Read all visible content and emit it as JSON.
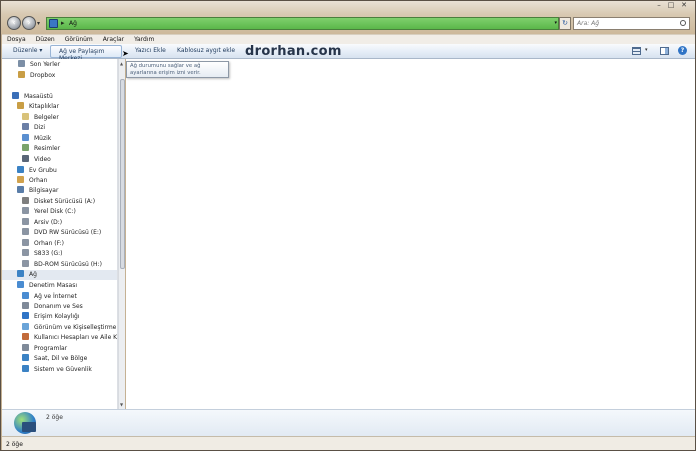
{
  "address": {
    "path": "Ağ"
  },
  "search": {
    "placeholder": "Ara: Ağ"
  },
  "menu": [
    "Dosya",
    "Düzen",
    "Görünüm",
    "Araçlar",
    "Yardım"
  ],
  "commands": {
    "organize": "Düzenle",
    "network_center": "Ağ ve Paylaşım Merkezi",
    "add_printer": "Yazıcı Ekle",
    "add_wireless": "Kablosuz aygıt ekle"
  },
  "watermark": "drorhan.com",
  "tooltip": "Ağ durumunu sağlar ve ağ ayarlarına erişim izni verir.",
  "nav": [
    {
      "label": "Son Yerler",
      "color": "#7c8fa6"
    },
    {
      "label": "Dropbox",
      "color": "#c99e45"
    },
    {
      "label": "Masaüstü",
      "color": "#3b6fb8"
    },
    {
      "label": "Kitaplıklar",
      "color": "#c99e45"
    },
    {
      "label": "Belgeler",
      "color": "#d8c27a"
    },
    {
      "label": "Dizi",
      "color": "#6b7fa6"
    },
    {
      "label": "Müzik",
      "color": "#5a8fd0"
    },
    {
      "label": "Resimler",
      "color": "#7aa36b"
    },
    {
      "label": "Video",
      "color": "#5a6678"
    },
    {
      "label": "Ev Grubu",
      "color": "#3b82c4"
    },
    {
      "label": "Orhan",
      "color": "#d1a24d"
    },
    {
      "label": "Bilgisayar",
      "color": "#5a7da8"
    },
    {
      "label": "Disket Sürücüsü (A:)",
      "color": "#7f7f7f"
    },
    {
      "label": "Yerel Disk (C:)",
      "color": "#8b95a3"
    },
    {
      "label": "Arsiv (D:)",
      "color": "#8b95a3"
    },
    {
      "label": "DVD RW Sürücüsü (E:)",
      "color": "#8b95a3"
    },
    {
      "label": "Orhan (F:)",
      "color": "#8b95a3"
    },
    {
      "label": "S833 (G:)",
      "color": "#8b95a3"
    },
    {
      "label": "BD-ROM Sürücüsü (H:)",
      "color": "#8b95a3"
    },
    {
      "label": "Ağ",
      "color": "#3b82c4"
    },
    {
      "label": "Denetim Masası",
      "color": "#4a8cd1"
    },
    {
      "label": "Ağ ve İnternet",
      "color": "#4a8cd1"
    },
    {
      "label": "Donanım ve Ses",
      "color": "#7f8a99"
    },
    {
      "label": "Erişim Kolaylığı",
      "color": "#2f74c6"
    },
    {
      "label": "Görünüm ve Kişiselleştirme",
      "color": "#6aa4d8"
    },
    {
      "label": "Kullanıcı Hesapları ve Aile Koru",
      "color": "#c26a3a"
    },
    {
      "label": "Programlar",
      "color": "#7f8a99"
    },
    {
      "label": "Saat, Dil ve Bölge",
      "color": "#3b82c4"
    },
    {
      "label": "Sistem ve Güvenlik",
      "color": "#3b82c4"
    }
  ],
  "details": {
    "count": "2 öğe"
  },
  "status": {
    "text": "2 öğe"
  }
}
